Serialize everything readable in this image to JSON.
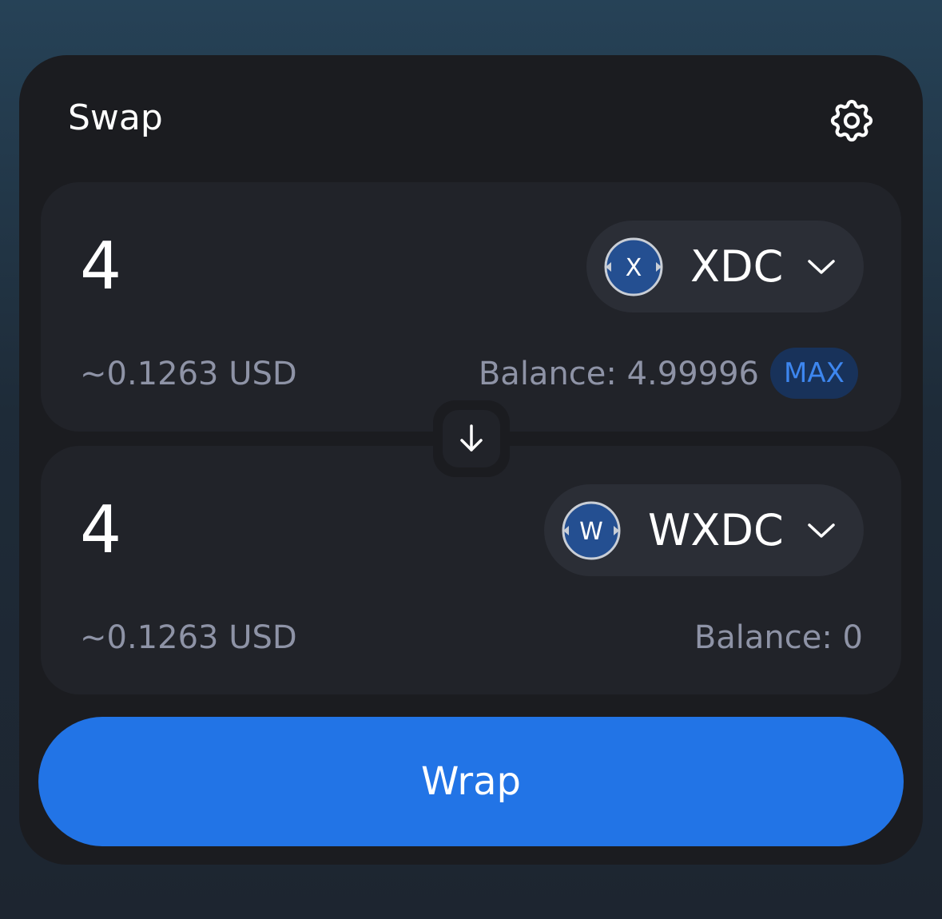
{
  "header": {
    "title": "Swap",
    "settings_icon": "gear-icon"
  },
  "from": {
    "amount": "4",
    "token_symbol": "XDC",
    "token_logo_letter": "X",
    "usd_value": "~0.1263 USD",
    "balance": "Balance: 4.99996",
    "max_label": "MAX"
  },
  "switch": {
    "icon": "arrow-down-icon"
  },
  "to": {
    "amount": "4",
    "token_symbol": "WXDC",
    "token_logo_letter": "W",
    "usd_value": "~0.1263 USD",
    "balance": "Balance: 0"
  },
  "action": {
    "label": "Wrap"
  },
  "colors": {
    "accent": "#2274e6",
    "card": "#1b1c20",
    "panel": "#212329",
    "token_pill": "#2b2e36",
    "muted_text": "#8e93a6",
    "max_bg": "#18325a",
    "max_text": "#3d86ef",
    "token_logo": "#244f91"
  }
}
